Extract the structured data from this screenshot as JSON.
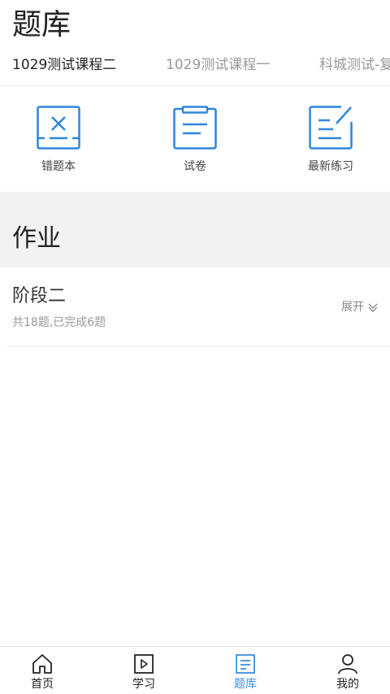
{
  "header": {
    "title": "题库"
  },
  "course_tabs": [
    {
      "label": "1029测试课程二",
      "active": true
    },
    {
      "label": "1029测试课程一",
      "active": false
    },
    {
      "label": "科城测试-复",
      "active": false
    }
  ],
  "tools": [
    {
      "label": "错题本",
      "icon": "wrong-book-icon"
    },
    {
      "label": "试卷",
      "icon": "exam-paper-icon"
    },
    {
      "label": "最新练习",
      "icon": "practice-edit-icon"
    }
  ],
  "section": {
    "title": "作业"
  },
  "homework": {
    "name": "阶段二",
    "progress": "共18题,已完成6题",
    "expand_label": "展开"
  },
  "tabbar": [
    {
      "label": "首页",
      "icon": "home-icon",
      "active": false
    },
    {
      "label": "学习",
      "icon": "play-icon",
      "active": false
    },
    {
      "label": "题库",
      "icon": "question-bank-icon",
      "active": true
    },
    {
      "label": "我的",
      "icon": "user-icon",
      "active": false
    }
  ],
  "colors": {
    "accent": "#3d8fe0",
    "icon_blue": "#2f86dc",
    "section_bg": "#f2f2f2"
  }
}
